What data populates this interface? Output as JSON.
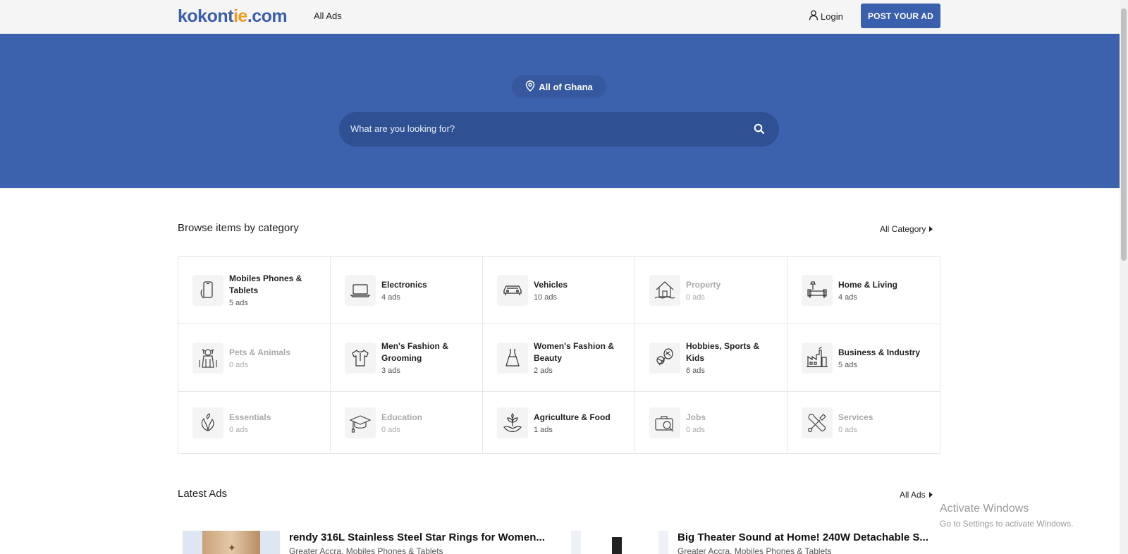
{
  "header": {
    "logo_text_a": "kokont",
    "logo_text_b": "ie",
    "logo_text_c": ".com",
    "nav_all_ads": "All Ads",
    "login_label": "Login",
    "post_button": "POST YOUR AD"
  },
  "hero": {
    "location_label": "All of Ghana",
    "search_placeholder": "What are you looking for?"
  },
  "categories": {
    "title": "Browse items by category",
    "all_link": "All Category",
    "items": [
      {
        "name": "Mobiles Phones & Tablets",
        "count": "5 ads",
        "icon": "phone-icon"
      },
      {
        "name": "Electronics",
        "count": "4 ads",
        "icon": "laptop-icon"
      },
      {
        "name": "Vehicles",
        "count": "10 ads",
        "icon": "car-icon"
      },
      {
        "name": "Property",
        "count": "0 ads",
        "icon": "house-icon"
      },
      {
        "name": "Home & Living",
        "count": "4 ads",
        "icon": "sofa-icon"
      },
      {
        "name": "Pets & Animals",
        "count": "0 ads",
        "icon": "dog-icon"
      },
      {
        "name": "Men's Fashion & Grooming",
        "count": "3 ads",
        "icon": "shirt-icon"
      },
      {
        "name": "Women's Fashion & Beauty",
        "count": "2 ads",
        "icon": "dress-icon"
      },
      {
        "name": "Hobbies, Sports & Kids",
        "count": "6 ads",
        "icon": "sports-icon"
      },
      {
        "name": "Business & Industry",
        "count": "5 ads",
        "icon": "factory-icon"
      },
      {
        "name": "Essentials",
        "count": "0 ads",
        "icon": "leaf-icon"
      },
      {
        "name": "Education",
        "count": "0 ads",
        "icon": "graduation-cap-icon"
      },
      {
        "name": "Agriculture & Food",
        "count": "1 ads",
        "icon": "plant-hand-icon"
      },
      {
        "name": "Jobs",
        "count": "0 ads",
        "icon": "briefcase-search-icon"
      },
      {
        "name": "Services",
        "count": "0 ads",
        "icon": "tools-icon"
      }
    ]
  },
  "latest": {
    "title": "Latest Ads",
    "all_link": "All Ads",
    "ads": [
      {
        "title": "rendy 316L Stainless Steel Star Rings for Women...",
        "meta": "Greater Accra, Mobiles Phones & Tablets"
      },
      {
        "title": "Big Theater Sound at Home! 240W Detachable S...",
        "meta": "Greater Accra, Mobiles Phones & Tablets"
      }
    ]
  },
  "watermark": {
    "title": "Activate Windows",
    "subtitle": "Go to Settings to activate Windows."
  },
  "colors": {
    "brand_blue": "#3c61ad",
    "brand_orange": "#f29b1e"
  }
}
